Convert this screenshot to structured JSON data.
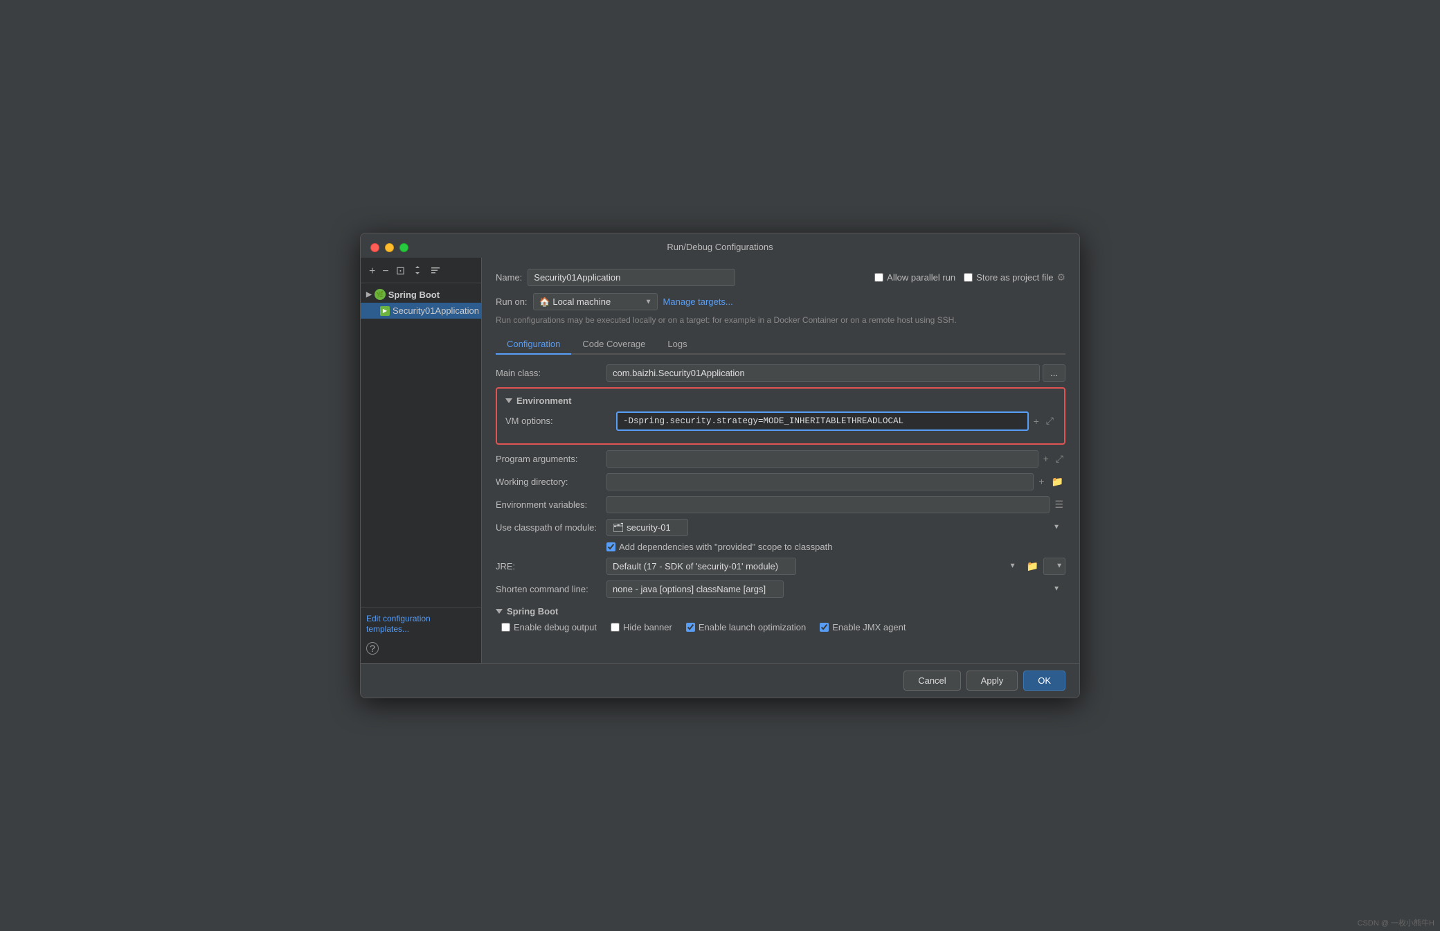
{
  "dialog": {
    "title": "Run/Debug Configurations"
  },
  "sidebar": {
    "toolbar": {
      "add_btn": "+",
      "remove_btn": "−",
      "copy_btn": "⊡",
      "move_up_btn": "↑↓",
      "sort_btn": "≡"
    },
    "tree": {
      "parent": {
        "label": "Spring Boot"
      },
      "child": {
        "label": "Security01Application"
      }
    },
    "edit_templates_label": "Edit configuration templates...",
    "help_label": "?"
  },
  "panel": {
    "name_label": "Name:",
    "name_value": "Security01Application",
    "allow_parallel_label": "Allow parallel run",
    "store_project_label": "Store as project file",
    "run_on_label": "Run on:",
    "run_on_value": "Local machine",
    "manage_targets_label": "Manage targets...",
    "hint_text": "Run configurations may be executed locally or on a target: for example in a Docker Container or on a remote host using SSH.",
    "tabs": [
      {
        "label": "Configuration",
        "active": true
      },
      {
        "label": "Code Coverage",
        "active": false
      },
      {
        "label": "Logs",
        "active": false
      }
    ],
    "main_class_label": "Main class:",
    "main_class_value": "com.baizhi.Security01Application",
    "environment_section_label": "Environment",
    "vm_options_label": "VM options:",
    "vm_options_value": "-Dspring.security.strategy=MODE_INHERITABLETHREADLOCAL",
    "program_args_label": "Program arguments:",
    "working_dir_label": "Working directory:",
    "env_vars_label": "Environment variables:",
    "classpath_label": "Use classpath of module:",
    "classpath_value": "security-01",
    "add_deps_label": "Add dependencies with \"provided\" scope to classpath",
    "jre_label": "JRE:",
    "jre_value": "Default (17 - SDK of 'security-01' module)",
    "shorten_cmd_label": "Shorten command line:",
    "shorten_cmd_value": "none - java [options] className [args]",
    "spring_boot_section_label": "Spring Boot",
    "enable_debug_label": "Enable debug output",
    "hide_banner_label": "Hide banner",
    "enable_launch_label": "Enable launch optimization",
    "enable_jmx_label": "Enable JMX agent"
  },
  "footer": {
    "cancel_label": "Cancel",
    "apply_label": "Apply",
    "ok_label": "OK"
  },
  "watermark": "CSDN @ 一枚小熊牛H"
}
